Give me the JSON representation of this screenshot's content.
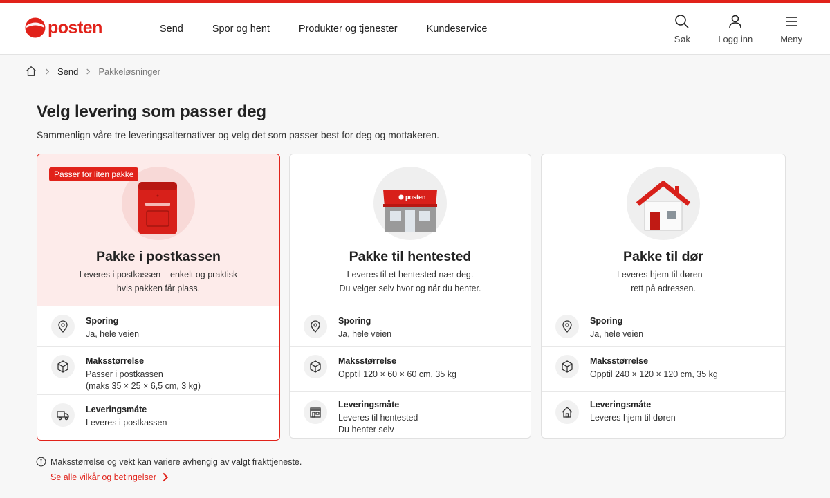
{
  "brand": {
    "name": "posten",
    "accent": "#e1221a"
  },
  "nav": {
    "items": [
      {
        "label": "Send"
      },
      {
        "label": "Spor og hent"
      },
      {
        "label": "Produkter og tjenester"
      },
      {
        "label": "Kundeservice"
      }
    ]
  },
  "header_actions": {
    "search": {
      "label": "Søk",
      "icon": "search-icon"
    },
    "login": {
      "label": "Logg inn",
      "icon": "user-icon"
    },
    "menu": {
      "label": "Meny",
      "icon": "hamburger-icon"
    }
  },
  "breadcrumb": {
    "items": [
      "Send",
      "Pakkeløsninger"
    ]
  },
  "page": {
    "title": "Velg levering som passer deg",
    "lead": "Sammenlign våre tre leveringsalternativer og velg det som passer best for deg og mottakeren."
  },
  "cards": [
    {
      "badge": "Passer for liten pakke",
      "title": "Pakke i postkassen",
      "desc_line1": "Leveres i postkassen – enkelt og praktisk",
      "desc_line2": "hvis pakken får plass.",
      "rows": [
        {
          "label": "Sporing",
          "value": "Ja, hele veien",
          "icon": "location-pin-icon"
        },
        {
          "label": "Maksstørrelse",
          "value": "Passer i postkassen",
          "value2": "(maks 35 × 25 × 6,5 cm, 3 kg)",
          "icon": "package-icon"
        },
        {
          "label": "Leveringsmåte",
          "value": "Leveres i postkassen",
          "icon": "truck-icon"
        }
      ]
    },
    {
      "title": "Pakke til hentested",
      "desc_line1": "Leveres til et hentested nær deg.",
      "desc_line2": "Du velger selv hvor og når du henter.",
      "rows": [
        {
          "label": "Sporing",
          "value": "Ja, hele veien",
          "icon": "location-pin-icon"
        },
        {
          "label": "Maksstørrelse",
          "value": "Opptil 120 × 60 × 60 cm, 35 kg",
          "icon": "package-icon"
        },
        {
          "label": "Leveringsmåte",
          "value": "Leveres til hentested",
          "value2": "Du henter selv",
          "icon": "store-icon"
        }
      ]
    },
    {
      "title": "Pakke til dør",
      "desc_line1": "Leveres hjem til døren –",
      "desc_line2": "rett på adressen.",
      "rows": [
        {
          "label": "Sporing",
          "value": "Ja, hele veien",
          "icon": "location-pin-icon"
        },
        {
          "label": "Maksstørrelse",
          "value": "Opptil 240 × 120 × 120 cm, 35 kg",
          "icon": "package-icon"
        },
        {
          "label": "Leveringsmåte",
          "value": "Leveres hjem til døren",
          "icon": "home-icon"
        }
      ]
    }
  ],
  "footer": {
    "note": "Maksstørrelse og vekt kan variere avhengig av valgt frakttjeneste.",
    "terms_link": "Se alle vilkår og betingelser"
  }
}
